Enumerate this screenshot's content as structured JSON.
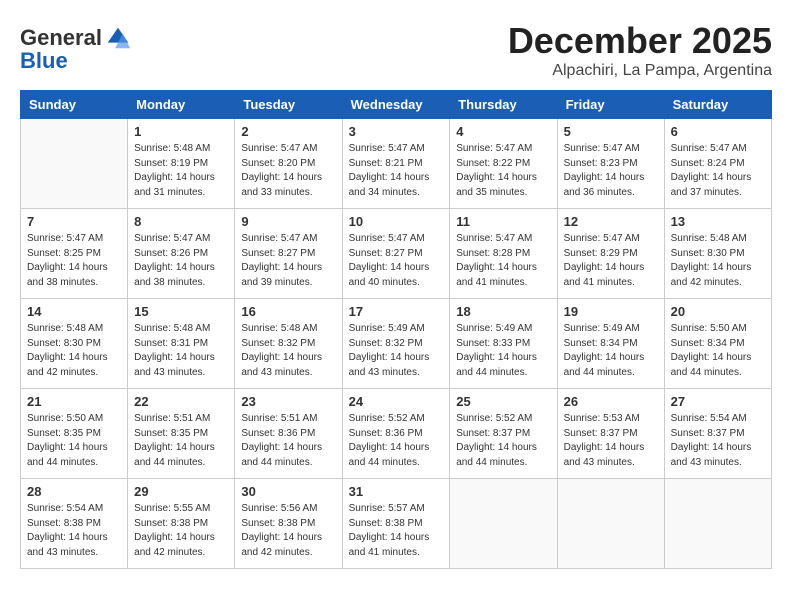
{
  "logo": {
    "text_general": "General",
    "text_blue": "Blue"
  },
  "title": "December 2025",
  "subtitle": "Alpachiri, La Pampa, Argentina",
  "days_of_week": [
    "Sunday",
    "Monday",
    "Tuesday",
    "Wednesday",
    "Thursday",
    "Friday",
    "Saturday"
  ],
  "weeks": [
    [
      {
        "day": null
      },
      {
        "day": "1",
        "sunrise": "Sunrise: 5:48 AM",
        "sunset": "Sunset: 8:19 PM",
        "daylight": "Daylight: 14 hours and 31 minutes."
      },
      {
        "day": "2",
        "sunrise": "Sunrise: 5:47 AM",
        "sunset": "Sunset: 8:20 PM",
        "daylight": "Daylight: 14 hours and 33 minutes."
      },
      {
        "day": "3",
        "sunrise": "Sunrise: 5:47 AM",
        "sunset": "Sunset: 8:21 PM",
        "daylight": "Daylight: 14 hours and 34 minutes."
      },
      {
        "day": "4",
        "sunrise": "Sunrise: 5:47 AM",
        "sunset": "Sunset: 8:22 PM",
        "daylight": "Daylight: 14 hours and 35 minutes."
      },
      {
        "day": "5",
        "sunrise": "Sunrise: 5:47 AM",
        "sunset": "Sunset: 8:23 PM",
        "daylight": "Daylight: 14 hours and 36 minutes."
      },
      {
        "day": "6",
        "sunrise": "Sunrise: 5:47 AM",
        "sunset": "Sunset: 8:24 PM",
        "daylight": "Daylight: 14 hours and 37 minutes."
      }
    ],
    [
      {
        "day": "7",
        "sunrise": "Sunrise: 5:47 AM",
        "sunset": "Sunset: 8:25 PM",
        "daylight": "Daylight: 14 hours and 38 minutes."
      },
      {
        "day": "8",
        "sunrise": "Sunrise: 5:47 AM",
        "sunset": "Sunset: 8:26 PM",
        "daylight": "Daylight: 14 hours and 38 minutes."
      },
      {
        "day": "9",
        "sunrise": "Sunrise: 5:47 AM",
        "sunset": "Sunset: 8:27 PM",
        "daylight": "Daylight: 14 hours and 39 minutes."
      },
      {
        "day": "10",
        "sunrise": "Sunrise: 5:47 AM",
        "sunset": "Sunset: 8:27 PM",
        "daylight": "Daylight: 14 hours and 40 minutes."
      },
      {
        "day": "11",
        "sunrise": "Sunrise: 5:47 AM",
        "sunset": "Sunset: 8:28 PM",
        "daylight": "Daylight: 14 hours and 41 minutes."
      },
      {
        "day": "12",
        "sunrise": "Sunrise: 5:47 AM",
        "sunset": "Sunset: 8:29 PM",
        "daylight": "Daylight: 14 hours and 41 minutes."
      },
      {
        "day": "13",
        "sunrise": "Sunrise: 5:48 AM",
        "sunset": "Sunset: 8:30 PM",
        "daylight": "Daylight: 14 hours and 42 minutes."
      }
    ],
    [
      {
        "day": "14",
        "sunrise": "Sunrise: 5:48 AM",
        "sunset": "Sunset: 8:30 PM",
        "daylight": "Daylight: 14 hours and 42 minutes."
      },
      {
        "day": "15",
        "sunrise": "Sunrise: 5:48 AM",
        "sunset": "Sunset: 8:31 PM",
        "daylight": "Daylight: 14 hours and 43 minutes."
      },
      {
        "day": "16",
        "sunrise": "Sunrise: 5:48 AM",
        "sunset": "Sunset: 8:32 PM",
        "daylight": "Daylight: 14 hours and 43 minutes."
      },
      {
        "day": "17",
        "sunrise": "Sunrise: 5:49 AM",
        "sunset": "Sunset: 8:32 PM",
        "daylight": "Daylight: 14 hours and 43 minutes."
      },
      {
        "day": "18",
        "sunrise": "Sunrise: 5:49 AM",
        "sunset": "Sunset: 8:33 PM",
        "daylight": "Daylight: 14 hours and 44 minutes."
      },
      {
        "day": "19",
        "sunrise": "Sunrise: 5:49 AM",
        "sunset": "Sunset: 8:34 PM",
        "daylight": "Daylight: 14 hours and 44 minutes."
      },
      {
        "day": "20",
        "sunrise": "Sunrise: 5:50 AM",
        "sunset": "Sunset: 8:34 PM",
        "daylight": "Daylight: 14 hours and 44 minutes."
      }
    ],
    [
      {
        "day": "21",
        "sunrise": "Sunrise: 5:50 AM",
        "sunset": "Sunset: 8:35 PM",
        "daylight": "Daylight: 14 hours and 44 minutes."
      },
      {
        "day": "22",
        "sunrise": "Sunrise: 5:51 AM",
        "sunset": "Sunset: 8:35 PM",
        "daylight": "Daylight: 14 hours and 44 minutes."
      },
      {
        "day": "23",
        "sunrise": "Sunrise: 5:51 AM",
        "sunset": "Sunset: 8:36 PM",
        "daylight": "Daylight: 14 hours and 44 minutes."
      },
      {
        "day": "24",
        "sunrise": "Sunrise: 5:52 AM",
        "sunset": "Sunset: 8:36 PM",
        "daylight": "Daylight: 14 hours and 44 minutes."
      },
      {
        "day": "25",
        "sunrise": "Sunrise: 5:52 AM",
        "sunset": "Sunset: 8:37 PM",
        "daylight": "Daylight: 14 hours and 44 minutes."
      },
      {
        "day": "26",
        "sunrise": "Sunrise: 5:53 AM",
        "sunset": "Sunset: 8:37 PM",
        "daylight": "Daylight: 14 hours and 43 minutes."
      },
      {
        "day": "27",
        "sunrise": "Sunrise: 5:54 AM",
        "sunset": "Sunset: 8:37 PM",
        "daylight": "Daylight: 14 hours and 43 minutes."
      }
    ],
    [
      {
        "day": "28",
        "sunrise": "Sunrise: 5:54 AM",
        "sunset": "Sunset: 8:38 PM",
        "daylight": "Daylight: 14 hours and 43 minutes."
      },
      {
        "day": "29",
        "sunrise": "Sunrise: 5:55 AM",
        "sunset": "Sunset: 8:38 PM",
        "daylight": "Daylight: 14 hours and 42 minutes."
      },
      {
        "day": "30",
        "sunrise": "Sunrise: 5:56 AM",
        "sunset": "Sunset: 8:38 PM",
        "daylight": "Daylight: 14 hours and 42 minutes."
      },
      {
        "day": "31",
        "sunrise": "Sunrise: 5:57 AM",
        "sunset": "Sunset: 8:38 PM",
        "daylight": "Daylight: 14 hours and 41 minutes."
      },
      {
        "day": null
      },
      {
        "day": null
      },
      {
        "day": null
      }
    ]
  ]
}
